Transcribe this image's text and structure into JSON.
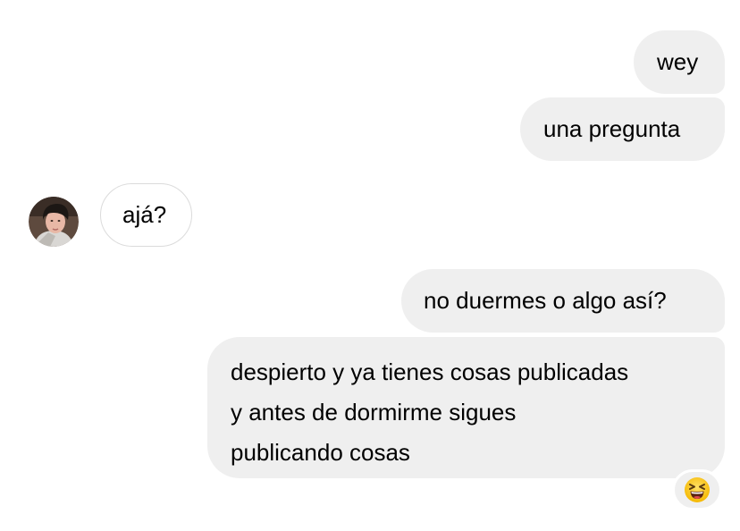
{
  "messages": {
    "sent_1": "wey",
    "sent_2": "una pregunta",
    "received_1": "ajá?",
    "sent_3": "no duermes o algo así?",
    "sent_4_lines": [
      "despierto y ya tienes cosas publicadas",
      "y antes de dormirme sigues",
      "publicando cosas"
    ]
  },
  "reaction": {
    "icon": "laughing-squinting-face-icon"
  },
  "avatar": {
    "icon": "user-avatar"
  },
  "colors": {
    "sent_bubble": "#efefef",
    "received_border": "#dbdbdb",
    "text": "#000000"
  }
}
